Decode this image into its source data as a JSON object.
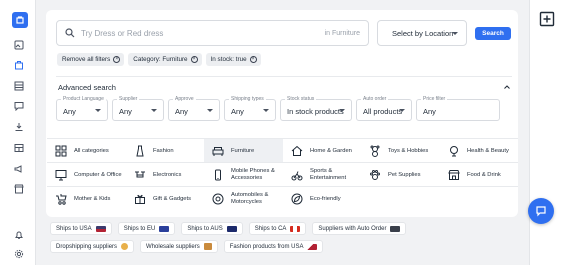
{
  "sidebar": {
    "logo_icon": "brand-logo-icon",
    "items": [
      {
        "name": "image-icon"
      },
      {
        "name": "storefront-icon",
        "active": true
      },
      {
        "name": "list-icon"
      },
      {
        "name": "chat-icon"
      },
      {
        "name": "download-icon"
      },
      {
        "name": "table-icon"
      },
      {
        "name": "megaphone-icon"
      },
      {
        "name": "store-icon"
      },
      {
        "name": "bell-icon"
      },
      {
        "name": "settings-icon"
      }
    ]
  },
  "right_rail": {
    "icon": "add-panel-icon"
  },
  "search": {
    "placeholder": "Try Dress or Red dress",
    "in_category": "in Furniture",
    "location_placeholder": "Select by Location",
    "button_label": "Search"
  },
  "active_filters": [
    {
      "label": "Remove all filters"
    },
    {
      "label": "Category: Furniture"
    },
    {
      "label": "In stock: true"
    }
  ],
  "advanced": {
    "title": "Advanced search",
    "filters": [
      {
        "label": "Product Language",
        "value": "Any"
      },
      {
        "label": "Supplier",
        "value": "Any"
      },
      {
        "label": "Approve",
        "value": "Any"
      },
      {
        "label": "Shipping types",
        "value": "Any"
      },
      {
        "label": "Stock status",
        "value": "In stock products"
      },
      {
        "label": "Auto order",
        "value": "All products"
      },
      {
        "label": "Price filter",
        "value": "Any"
      }
    ]
  },
  "categories": [
    [
      "All categories",
      "Fashion",
      "Furniture",
      "Home & Garden",
      "Toys & Hobbies",
      "Health & Beauty"
    ],
    [
      "Computer & Office",
      "Electronics",
      "Mobile Phones & Accessories",
      "Sports & Entertainment",
      "Pet Supplies",
      "Food & Drink"
    ],
    [
      "Mother & Kids",
      "Gift & Gadgets",
      "Automobiles & Motorcycles",
      "Eco-friendly"
    ]
  ],
  "selected_category": "Furniture",
  "tags": {
    "row1": [
      "Ships to USA",
      "Ships to EU",
      "Ships to AUS",
      "Ships to CA",
      "Suppliers with Auto Order"
    ],
    "row2": [
      "Dropshipping suppliers",
      "Wholesale suppliers",
      "Fashion products from USA"
    ]
  },
  "colors": {
    "accent": "#2f6ff0",
    "chip_bg": "#eceef1",
    "page_bg": "#f1f2f4"
  }
}
